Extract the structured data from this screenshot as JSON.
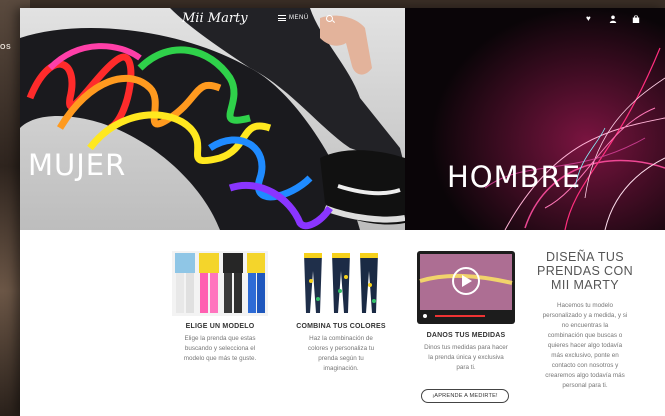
{
  "background_fragment": "OS",
  "header": {
    "logo_text": "Mii Marty",
    "menu_label": "MENÚ",
    "icons": [
      "heart-icon",
      "user-icon",
      "bag-icon"
    ]
  },
  "hero": {
    "left_title": "MUJER",
    "right_title": "HOMBRE"
  },
  "steps": [
    {
      "title": "ELIGE UN MODELO",
      "text": [
        "Elige la prenda que estas",
        "buscando y selecciona el",
        "modelo que más te guste."
      ]
    },
    {
      "title": "COMBINA TUS COLORES",
      "text": [
        "Haz la combinación de",
        "colores y personaliza tu",
        "prenda según tu",
        "imaginación."
      ]
    },
    {
      "title": "DANOS TUS MEDIDAS",
      "text": [
        "Dinos tus medidas para hacer",
        "la prenda única y exclusiva",
        "para ti."
      ],
      "button": "¡APRENDE A MEDIRTE!"
    }
  ],
  "design": {
    "title": [
      "DISEÑA TUS",
      "PRENDAS CON",
      "MII MARTY"
    ],
    "text": [
      "Hacemos tu modelo",
      "personalizado y a medida, y si",
      "no encuentras la",
      "combinación que buscas o",
      "quieres hacer algo todavía",
      "más exclusivo, ponte en",
      "contacto con nosotros y",
      "crearemos algo todavía más",
      "personal para ti."
    ]
  },
  "colors": {
    "page_bg": "#ffffff",
    "hero_right_bg": "#0a0508",
    "text_dark": "#333333",
    "text_muted": "#777777"
  }
}
